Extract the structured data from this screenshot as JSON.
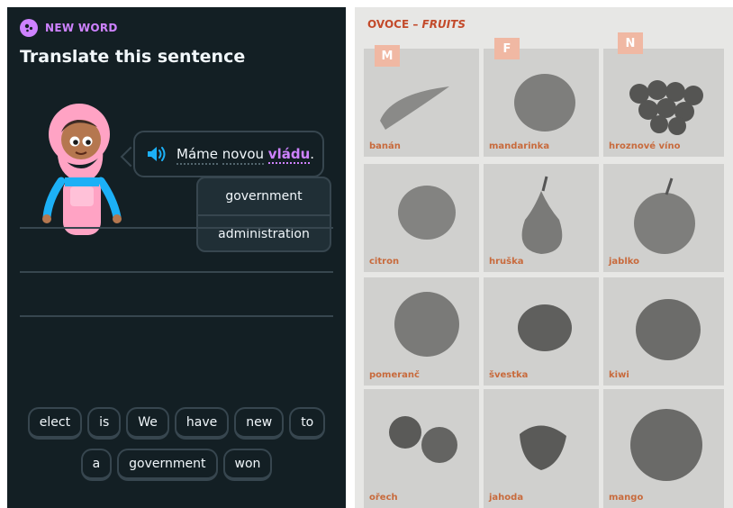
{
  "app": {
    "badge": "NEW WORD",
    "prompt": "Translate this sentence",
    "sentence": {
      "words": [
        "Máme",
        "novou"
      ],
      "highlight": "vládu",
      "punct": "."
    },
    "tooltip": [
      "government",
      "administration"
    ],
    "word_bank": {
      "row1": [
        "elect",
        "is",
        "We",
        "have",
        "new",
        "to"
      ],
      "row2": [
        "a",
        "government",
        "won"
      ]
    },
    "colors": {
      "background": "#131f24",
      "accent": "#ce82ff",
      "speaker": "#1cb0f6",
      "border": "#37464f"
    }
  },
  "book": {
    "title_cz": "OVOCE –",
    "title_en": "FRUITS",
    "genders": [
      "M",
      "F",
      "N"
    ],
    "fruits": [
      [
        "banán",
        "mandarinka",
        "hroznové víno"
      ],
      [
        "citron",
        "hruška",
        "jablko"
      ],
      [
        "pomeranč",
        "švestka",
        "kiwi"
      ],
      [
        "ořech",
        "jahoda",
        "mango"
      ]
    ]
  }
}
